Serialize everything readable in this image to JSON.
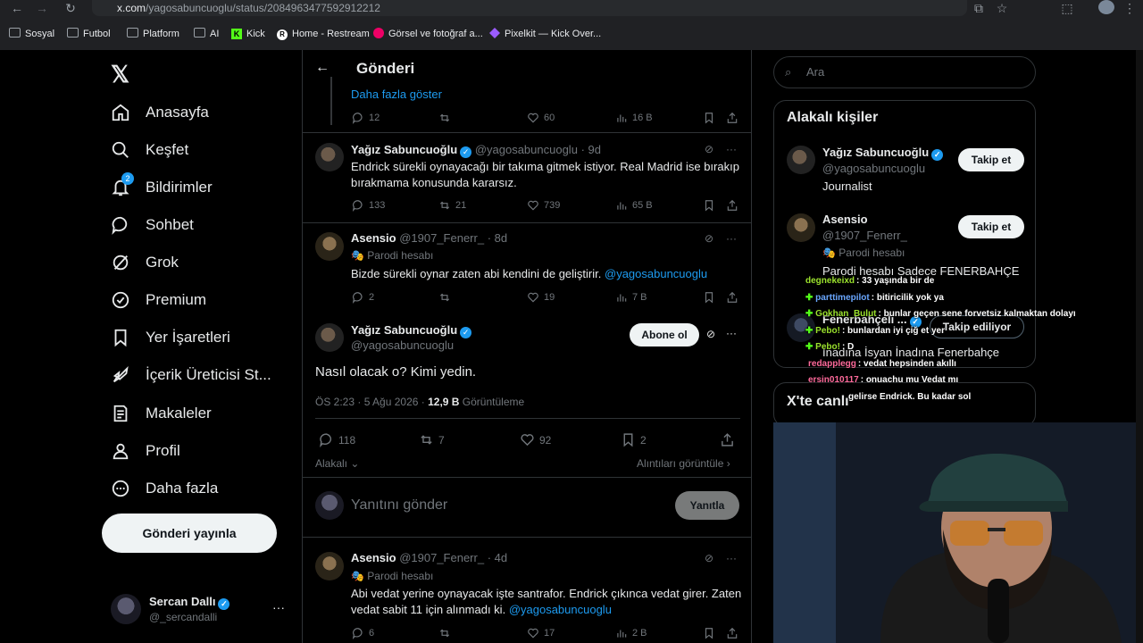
{
  "browser": {
    "url_host": "x.com",
    "url_path": "/yagosabuncuoglu/status/2084963477592912212",
    "bookmarks": [
      "Sosyal",
      "Futbol",
      "Platform",
      "AI",
      "Kick",
      "Home - Restream",
      "Görsel ve fotoğraf a...",
      "Pixelkit — Kick Over..."
    ]
  },
  "sidebar": {
    "items": [
      {
        "label": "Anasayfa",
        "icon": "home-icon"
      },
      {
        "label": "Keşfet",
        "icon": "search-icon"
      },
      {
        "label": "Bildirimler",
        "icon": "bell-icon",
        "badge": "2"
      },
      {
        "label": "Sohbet",
        "icon": "chat-icon"
      },
      {
        "label": "Grok",
        "icon": "grok-icon"
      },
      {
        "label": "Premium",
        "icon": "premium-icon"
      },
      {
        "label": "Yer İşaretleri",
        "icon": "bookmark-icon"
      },
      {
        "label": "İçerik Üreticisi St...",
        "icon": "rocket-icon"
      },
      {
        "label": "Makaleler",
        "icon": "article-icon"
      },
      {
        "label": "Profil",
        "icon": "profile-icon"
      },
      {
        "label": "Daha fazla",
        "icon": "more-icon"
      }
    ],
    "post_button": "Gönderi yayınla",
    "account": {
      "name": "Sercan Dallı",
      "handle": "@_sercandalli"
    }
  },
  "header": {
    "title": "Gönderi"
  },
  "thread": {
    "show_more": "Daha fazla göster",
    "top_actions": {
      "replies": "12",
      "likes": "60",
      "views": "16 B"
    },
    "tweet1": {
      "name": "Yağız Sabuncuoğlu",
      "handle": "@yagosabuncuoglu",
      "time": "· 9d",
      "text": "Endrick sürekli oynayacağı bir takıma gitmek istiyor. Real Madrid ise bırakıp bırakmama konusunda kararsız.",
      "replies": "133",
      "retweets": "21",
      "likes": "739",
      "views": "65 B"
    },
    "tweet2": {
      "name": "Asensio",
      "handle": "@1907_Fenerr_",
      "time": "· 8d",
      "badge": "Parodi hesabı",
      "text": "Bizde sürekli oynar zaten abi kendini de geliştirir.",
      "mention": "@yagosabuncuoglu",
      "replies": "2",
      "likes": "19",
      "views": "7 B"
    },
    "main": {
      "name": "Yağız Sabuncuoğlu",
      "handle": "@yagosabuncuoglu",
      "subscribe": "Abone ol",
      "text": "Nasıl olacak o? Kimi yedin.",
      "meta_time": "ÖS 2:23 · 5 Ağu 2026 ·",
      "meta_views": "12,9 B",
      "meta_views_label": "Görüntüleme",
      "replies": "118",
      "retweets": "7",
      "likes": "92",
      "bookmarks": "2",
      "sort": "Alakalı",
      "quotes": "Alıntıları görüntüle"
    },
    "reply_box": {
      "placeholder": "Yanıtını gönder",
      "button": "Yanıtla"
    },
    "tweet3": {
      "name": "Asensio",
      "handle": "@1907_Fenerr_",
      "time": "· 4d",
      "badge": "Parodi hesabı",
      "text": "Abi vedat yerine oynayacak işte santrafor. Endrick çıkınca vedat girer. Zaten vedat sabit 11 için alınmadı ki.",
      "mention": "@yagosabuncuoglu",
      "replies": "6",
      "likes": "17",
      "views": "2 B"
    }
  },
  "right": {
    "search_placeholder": "Ara",
    "related_title": "Alakalı kişiler",
    "people": [
      {
        "name": "Yağız Sabuncuoğlu",
        "handle": "@yagosabuncuoglu",
        "bio": "Journalist",
        "button": "Takip et"
      },
      {
        "name": "Asensio",
        "handle": "@1907_Fenerr_",
        "badge": "Parodi hesabı",
        "bio": "Parodi hesabı Sadece FENERBAHÇE",
        "button": "Takip et"
      },
      {
        "name": "Fenerbahçeli ...",
        "bio": "İnadına İsyan İnadına Fenerbahçe",
        "button": "Takip ediliyor"
      }
    ],
    "trends_title": "X'te canlı"
  },
  "chat": [
    {
      "user": "degnekeixd",
      "msg": ": 33 yaşında bir de",
      "color": "#9be22d"
    },
    {
      "user": "parttimepilot",
      "msg": ": bitiricilik yok ya",
      "color": "#6aa7ff"
    },
    {
      "user": "Gokhan_Bulut",
      "msg": ": bunlar geçen sene forvetsiz kalmaktan dolayı",
      "color": "#9be22d"
    },
    {
      "user": "Pebo!",
      "msg": ": bunlardan iyi çiğ et yer",
      "color": "#9be22d"
    },
    {
      "user": "Pebo!",
      "msg": ": D",
      "color": "#9be22d"
    },
    {
      "user": "redapplegg",
      "msg": ": vedat hepsinden akıllı",
      "color": "#ff6a9b"
    },
    {
      "user": "ersin010117",
      "msg": ": onuachu mu Vedat mı",
      "color": "#ff6a9b"
    },
    {
      "user": "",
      "msg": "gelirse Endrick. Bu kadar sol",
      "color": "#ffffff"
    }
  ],
  "colors": {
    "accent": "#1d9bf0",
    "bg": "#000000",
    "border": "#2f3336"
  }
}
